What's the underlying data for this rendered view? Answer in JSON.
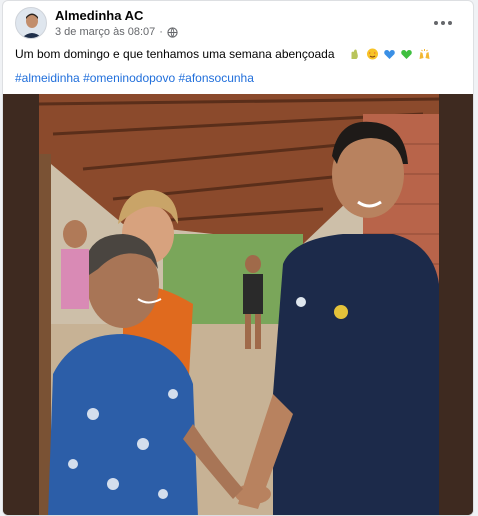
{
  "post": {
    "author": "Almedinha AC",
    "timestamp": "3 de março às 08:07",
    "separator": "·",
    "privacy_icon": "globe-icon",
    "text": "Um bom domingo e que tenhamos uma semana abençoada",
    "emojis": [
      "hand-icon",
      "star-eyes-emoji",
      "blue-heart-emoji",
      "green-heart-emoji",
      "raised-hands-emoji"
    ],
    "hashtags": [
      "#almeidinha",
      "#omeninodopovo",
      "#afonsocunha"
    ],
    "more_icon": "more-options-icon"
  }
}
